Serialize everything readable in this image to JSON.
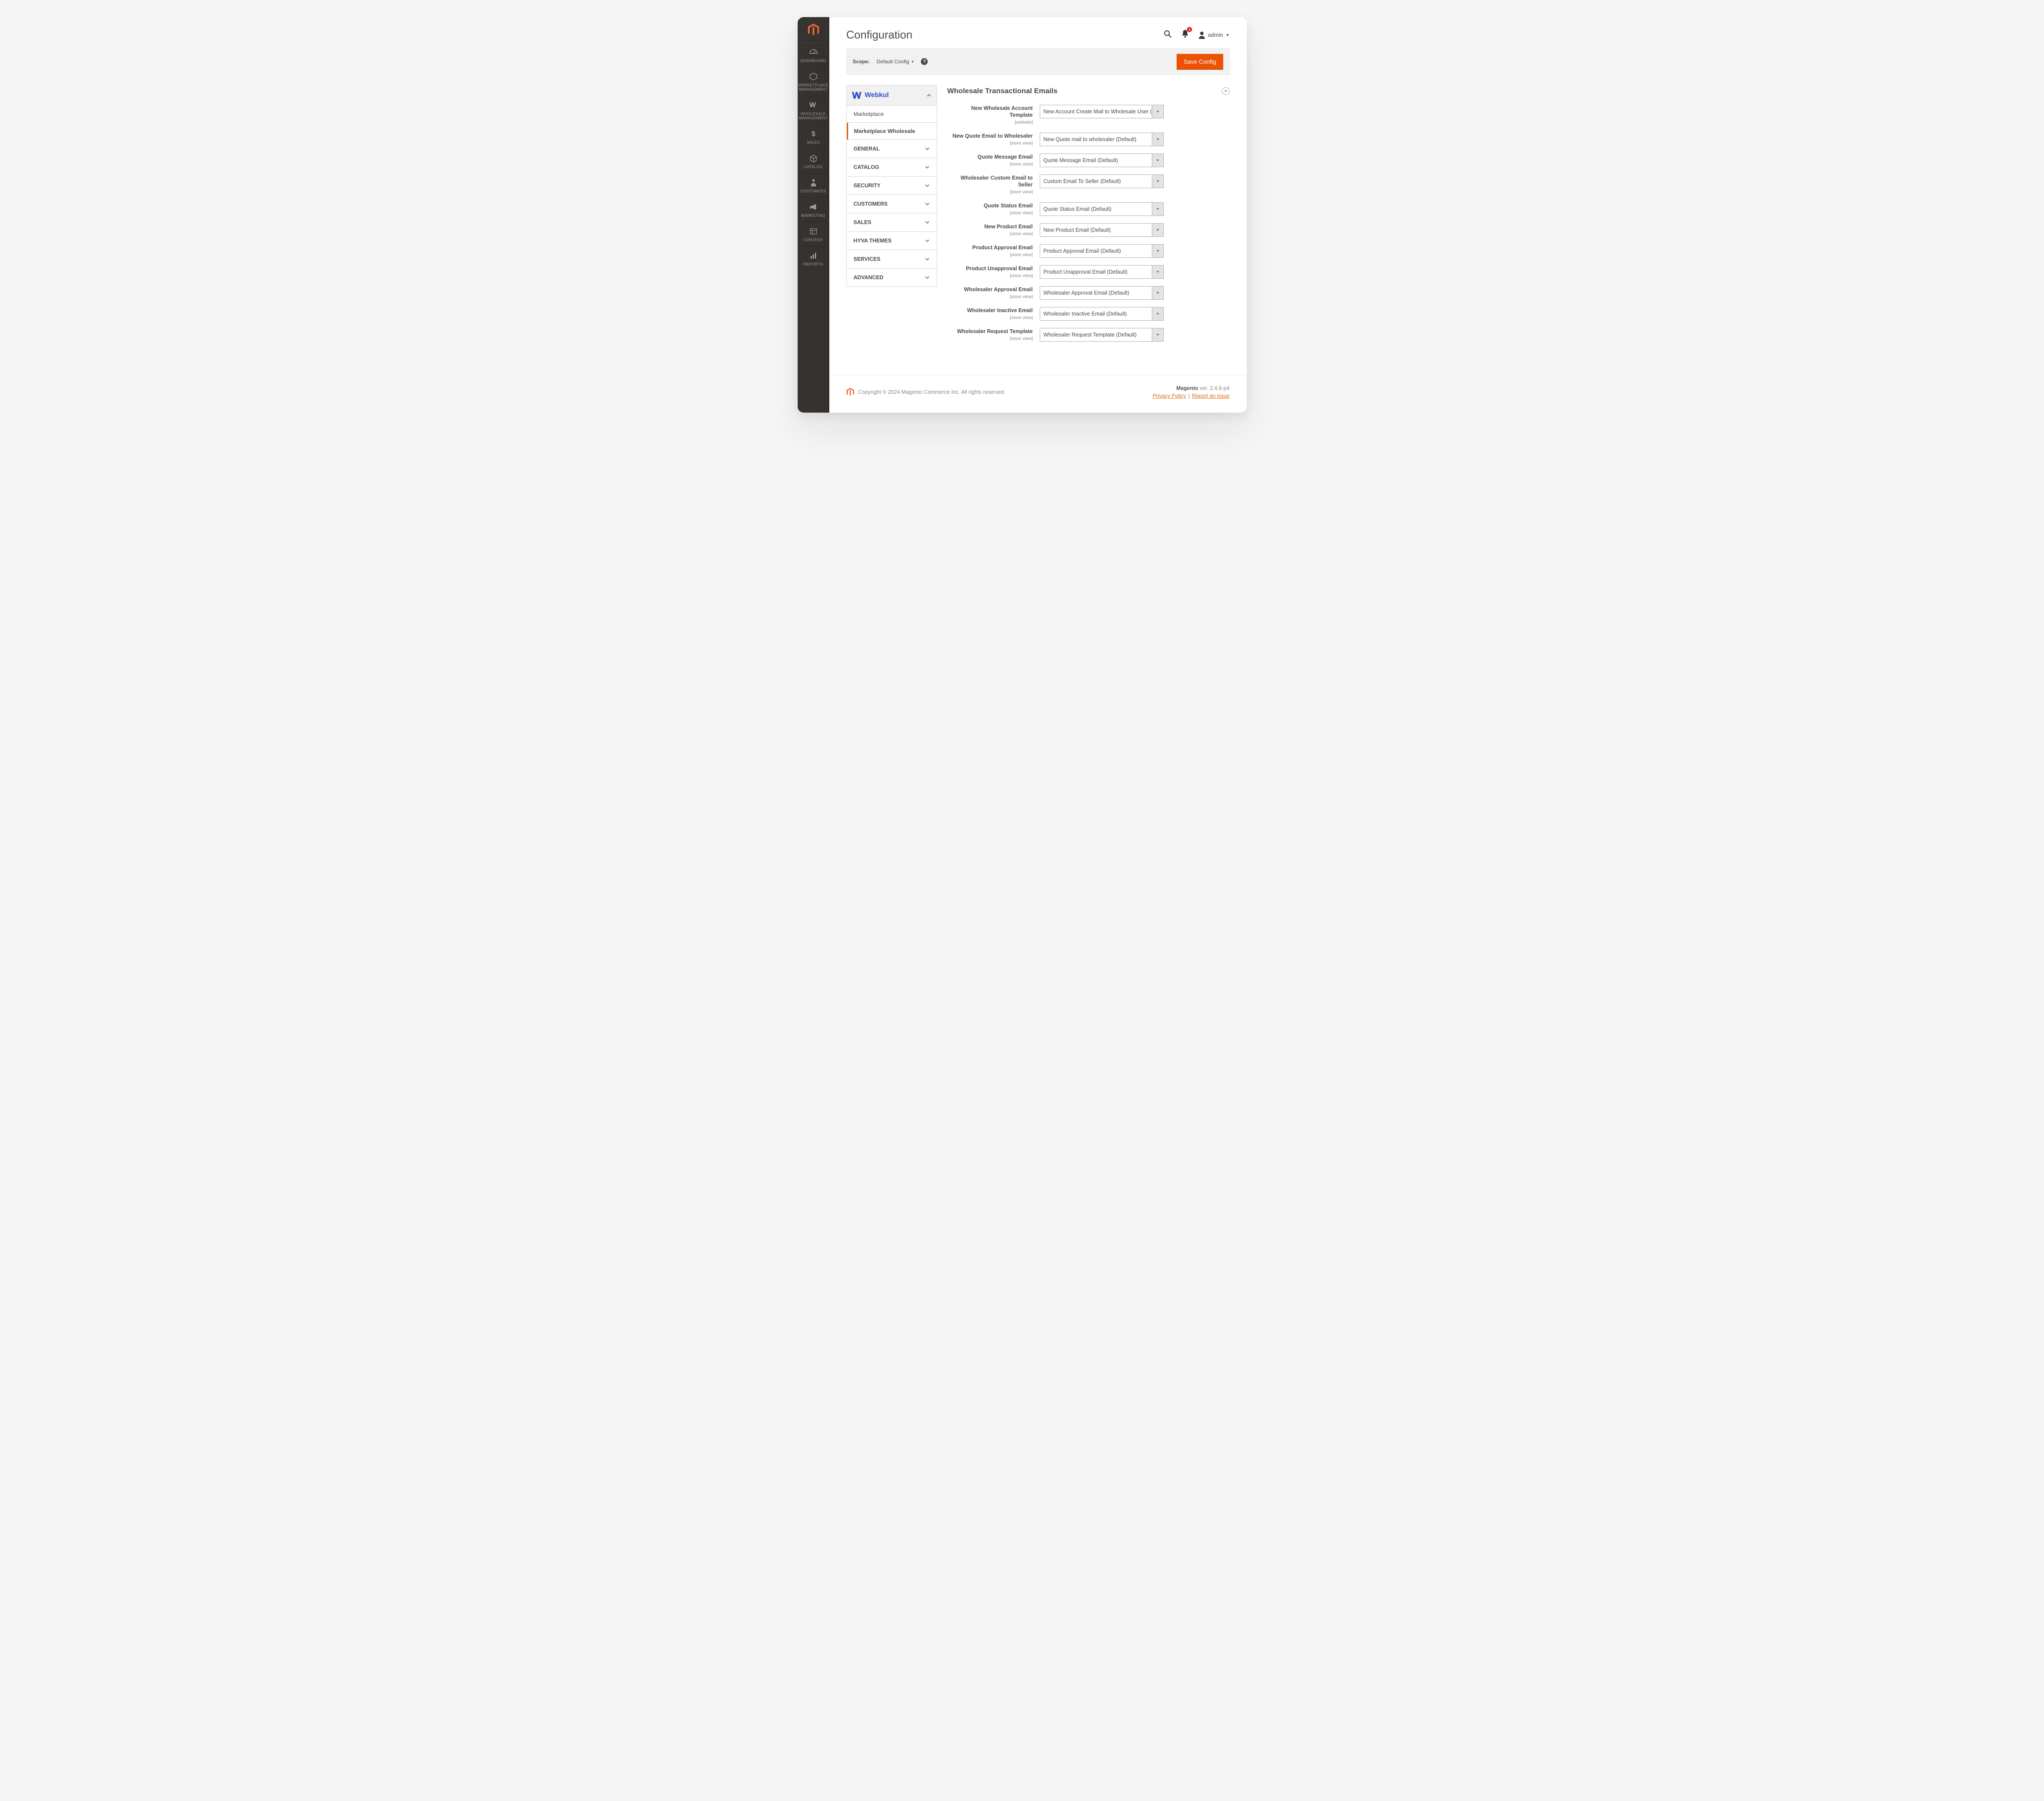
{
  "header": {
    "page_title": "Configuration",
    "notification_count": "1",
    "user": "admin"
  },
  "scopebar": {
    "label": "Scope:",
    "value": "Default Config",
    "save_label": "Save Config"
  },
  "sidebar": {
    "items": [
      {
        "id": "dashboard",
        "label": "DASHBOARD"
      },
      {
        "id": "mp-mgmt",
        "label": "MARKETPLACE MANAGEMENT"
      },
      {
        "id": "ws-mgmt",
        "label": "WHOLESALE MANAGEMENT"
      },
      {
        "id": "sales",
        "label": "SALES"
      },
      {
        "id": "catalog",
        "label": "CATALOG"
      },
      {
        "id": "customers",
        "label": "CUSTOMERS"
      },
      {
        "id": "marketing",
        "label": "MARKETING"
      },
      {
        "id": "content",
        "label": "CONTENT"
      },
      {
        "id": "reports",
        "label": "REPORTS"
      }
    ]
  },
  "confignav": {
    "vendor": "Webkul",
    "subs": [
      {
        "label": "Marketplace",
        "active": false
      },
      {
        "label": "Marketplace Wholesale",
        "active": true
      }
    ],
    "groups": [
      "GENERAL",
      "CATALOG",
      "SECURITY",
      "CUSTOMERS",
      "SALES",
      "HYVA THEMES",
      "SERVICES",
      "ADVANCED"
    ]
  },
  "section": {
    "title": "Wholesale Transactional Emails"
  },
  "fields": [
    {
      "label": "New Wholesale Account Template",
      "scope": "[website]",
      "value": "New Account Create Mail to Wholesale User (Default)"
    },
    {
      "label": "New Quote Email to Wholesaler",
      "scope": "[store view]",
      "value": "New Quote mail to wholesaler (Default)"
    },
    {
      "label": "Quote Message Email",
      "scope": "[store view]",
      "value": "Quote Message Email (Default)"
    },
    {
      "label": "Wholesaler Custom Email to Seller",
      "scope": "[store view]",
      "value": "Custom Email To Seller (Default)"
    },
    {
      "label": "Quote Status Email",
      "scope": "[store view]",
      "value": "Quote Status Email (Default)"
    },
    {
      "label": "New Product Email",
      "scope": "[store view]",
      "value": "New Product Email (Default)"
    },
    {
      "label": "Product Approval Email",
      "scope": "[store view]",
      "value": "Product Approval Email (Default)"
    },
    {
      "label": "Product Unapproval Email",
      "scope": "[store view]",
      "value": "Product Unapproval Email (Default)"
    },
    {
      "label": "Wholesaler Approval Email",
      "scope": "[store view]",
      "value": "Wholesaler Approval Email (Default)"
    },
    {
      "label": "Wholesaler Inactive Email",
      "scope": "[store view]",
      "value": "Wholesaler Inactive Email (Default)"
    },
    {
      "label": "Wholesaler Request Template",
      "scope": "[store view]",
      "value": "Wholesaler Request Template (Default)"
    }
  ],
  "footer": {
    "copyright": "Copyright © 2024 Magento Commerce Inc. All rights reserved.",
    "app": "Magento",
    "version": "ver. 2.4.6-p4",
    "privacy": "Privacy Policy",
    "report": "Report an issue"
  }
}
